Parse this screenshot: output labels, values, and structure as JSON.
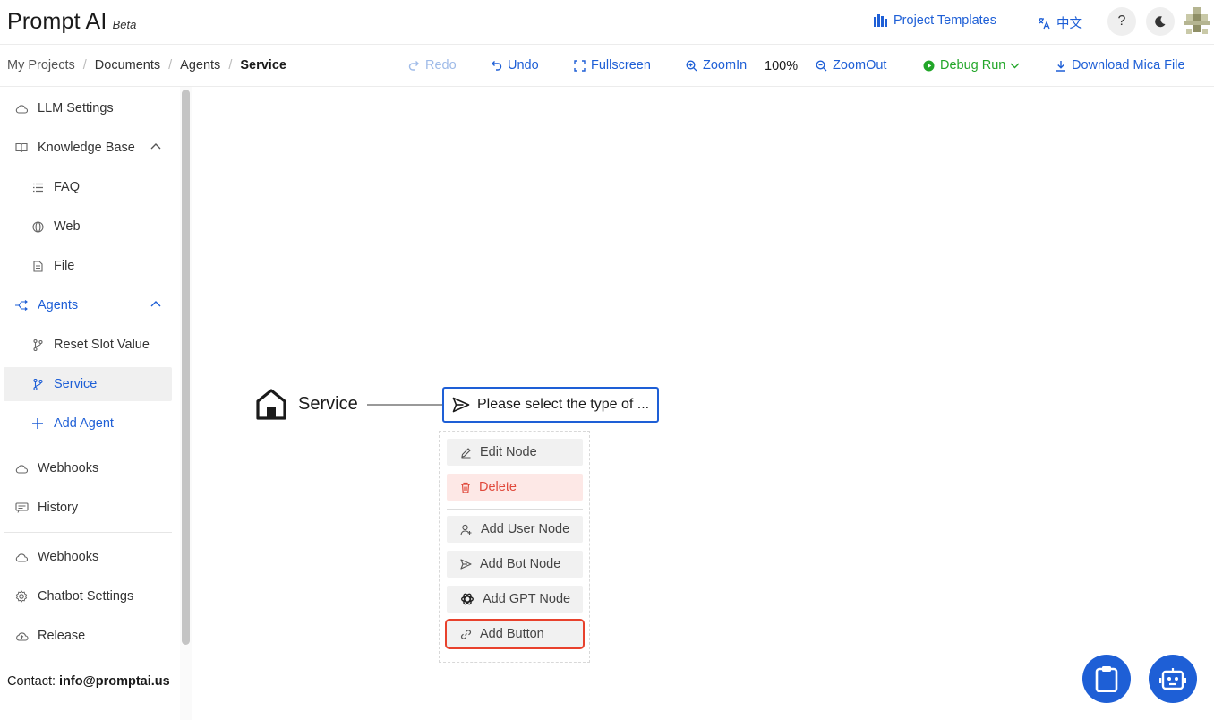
{
  "header": {
    "title": "Prompt AI",
    "badge": "Beta",
    "project_templates": "Project Templates",
    "language": "中文",
    "help": "?"
  },
  "breadcrumb": [
    "My Projects",
    "Documents",
    "Agents",
    "Service"
  ],
  "toolbar": {
    "redo": "Redo",
    "undo": "Undo",
    "fullscreen": "Fullscreen",
    "zoom_in": "ZoomIn",
    "zoom_level": "100%",
    "zoom_out": "ZoomOut",
    "debug_run": "Debug Run",
    "download": "Download Mica File"
  },
  "sidebar": {
    "items": [
      {
        "label": "LLM Settings"
      },
      {
        "label": "Knowledge Base"
      },
      {
        "label": "FAQ"
      },
      {
        "label": "Web"
      },
      {
        "label": "File"
      },
      {
        "label": "Agents"
      },
      {
        "label": "Reset Slot Value"
      },
      {
        "label": "Service"
      },
      {
        "label": "Add Agent"
      },
      {
        "label": "Webhooks"
      },
      {
        "label": "History"
      },
      {
        "label": "Webhooks"
      },
      {
        "label": "Chatbot Settings"
      },
      {
        "label": "Release"
      }
    ],
    "contact_label": "Contact:",
    "contact_email": "info@promptai.us"
  },
  "canvas": {
    "start_label": "Service",
    "bot_node_text": "Please select the type of ..."
  },
  "context_menu": {
    "edit_node": "Edit Node",
    "delete": "Delete",
    "add_user_node": "Add User Node",
    "add_bot_node": "Add Bot Node",
    "add_gpt_node": "Add GPT Node",
    "add_button": "Add Button"
  },
  "colors": {
    "accent": "#1e5fd6",
    "success": "#22a629",
    "danger": "#e0493b",
    "highlight": "#e8412c"
  }
}
